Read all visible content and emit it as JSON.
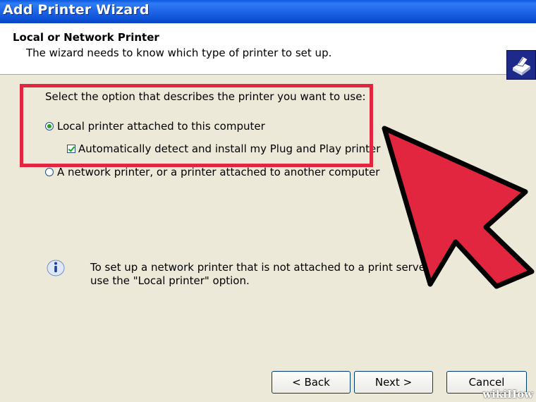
{
  "window": {
    "title": "Add Printer Wizard"
  },
  "header": {
    "title": "Local or Network Printer",
    "subtitle": "The wizard needs to know which type of printer to set up.",
    "icon": "printer-icon"
  },
  "options": {
    "prompt": "Select the option that describes the printer you want to use:",
    "local_label": "Local printer attached to this computer",
    "local_selected": true,
    "auto_detect_label": "Automatically detect and install my Plug and Play printer",
    "auto_detect_checked": true,
    "network_label": "A network printer, or a printer attached to another computer",
    "network_selected": false
  },
  "info": {
    "icon": "info-icon",
    "line1": "To set up a network printer that is not attached to a print server,",
    "line2": "use the \"Local printer\" option."
  },
  "buttons": {
    "back_label": "< Back",
    "next_label": "Next >",
    "cancel_label": "Cancel"
  },
  "annotation": {
    "highlight_color": "#e3263f",
    "arrow_color": "#e3263f"
  },
  "watermark": {
    "text": "wikiHow"
  }
}
